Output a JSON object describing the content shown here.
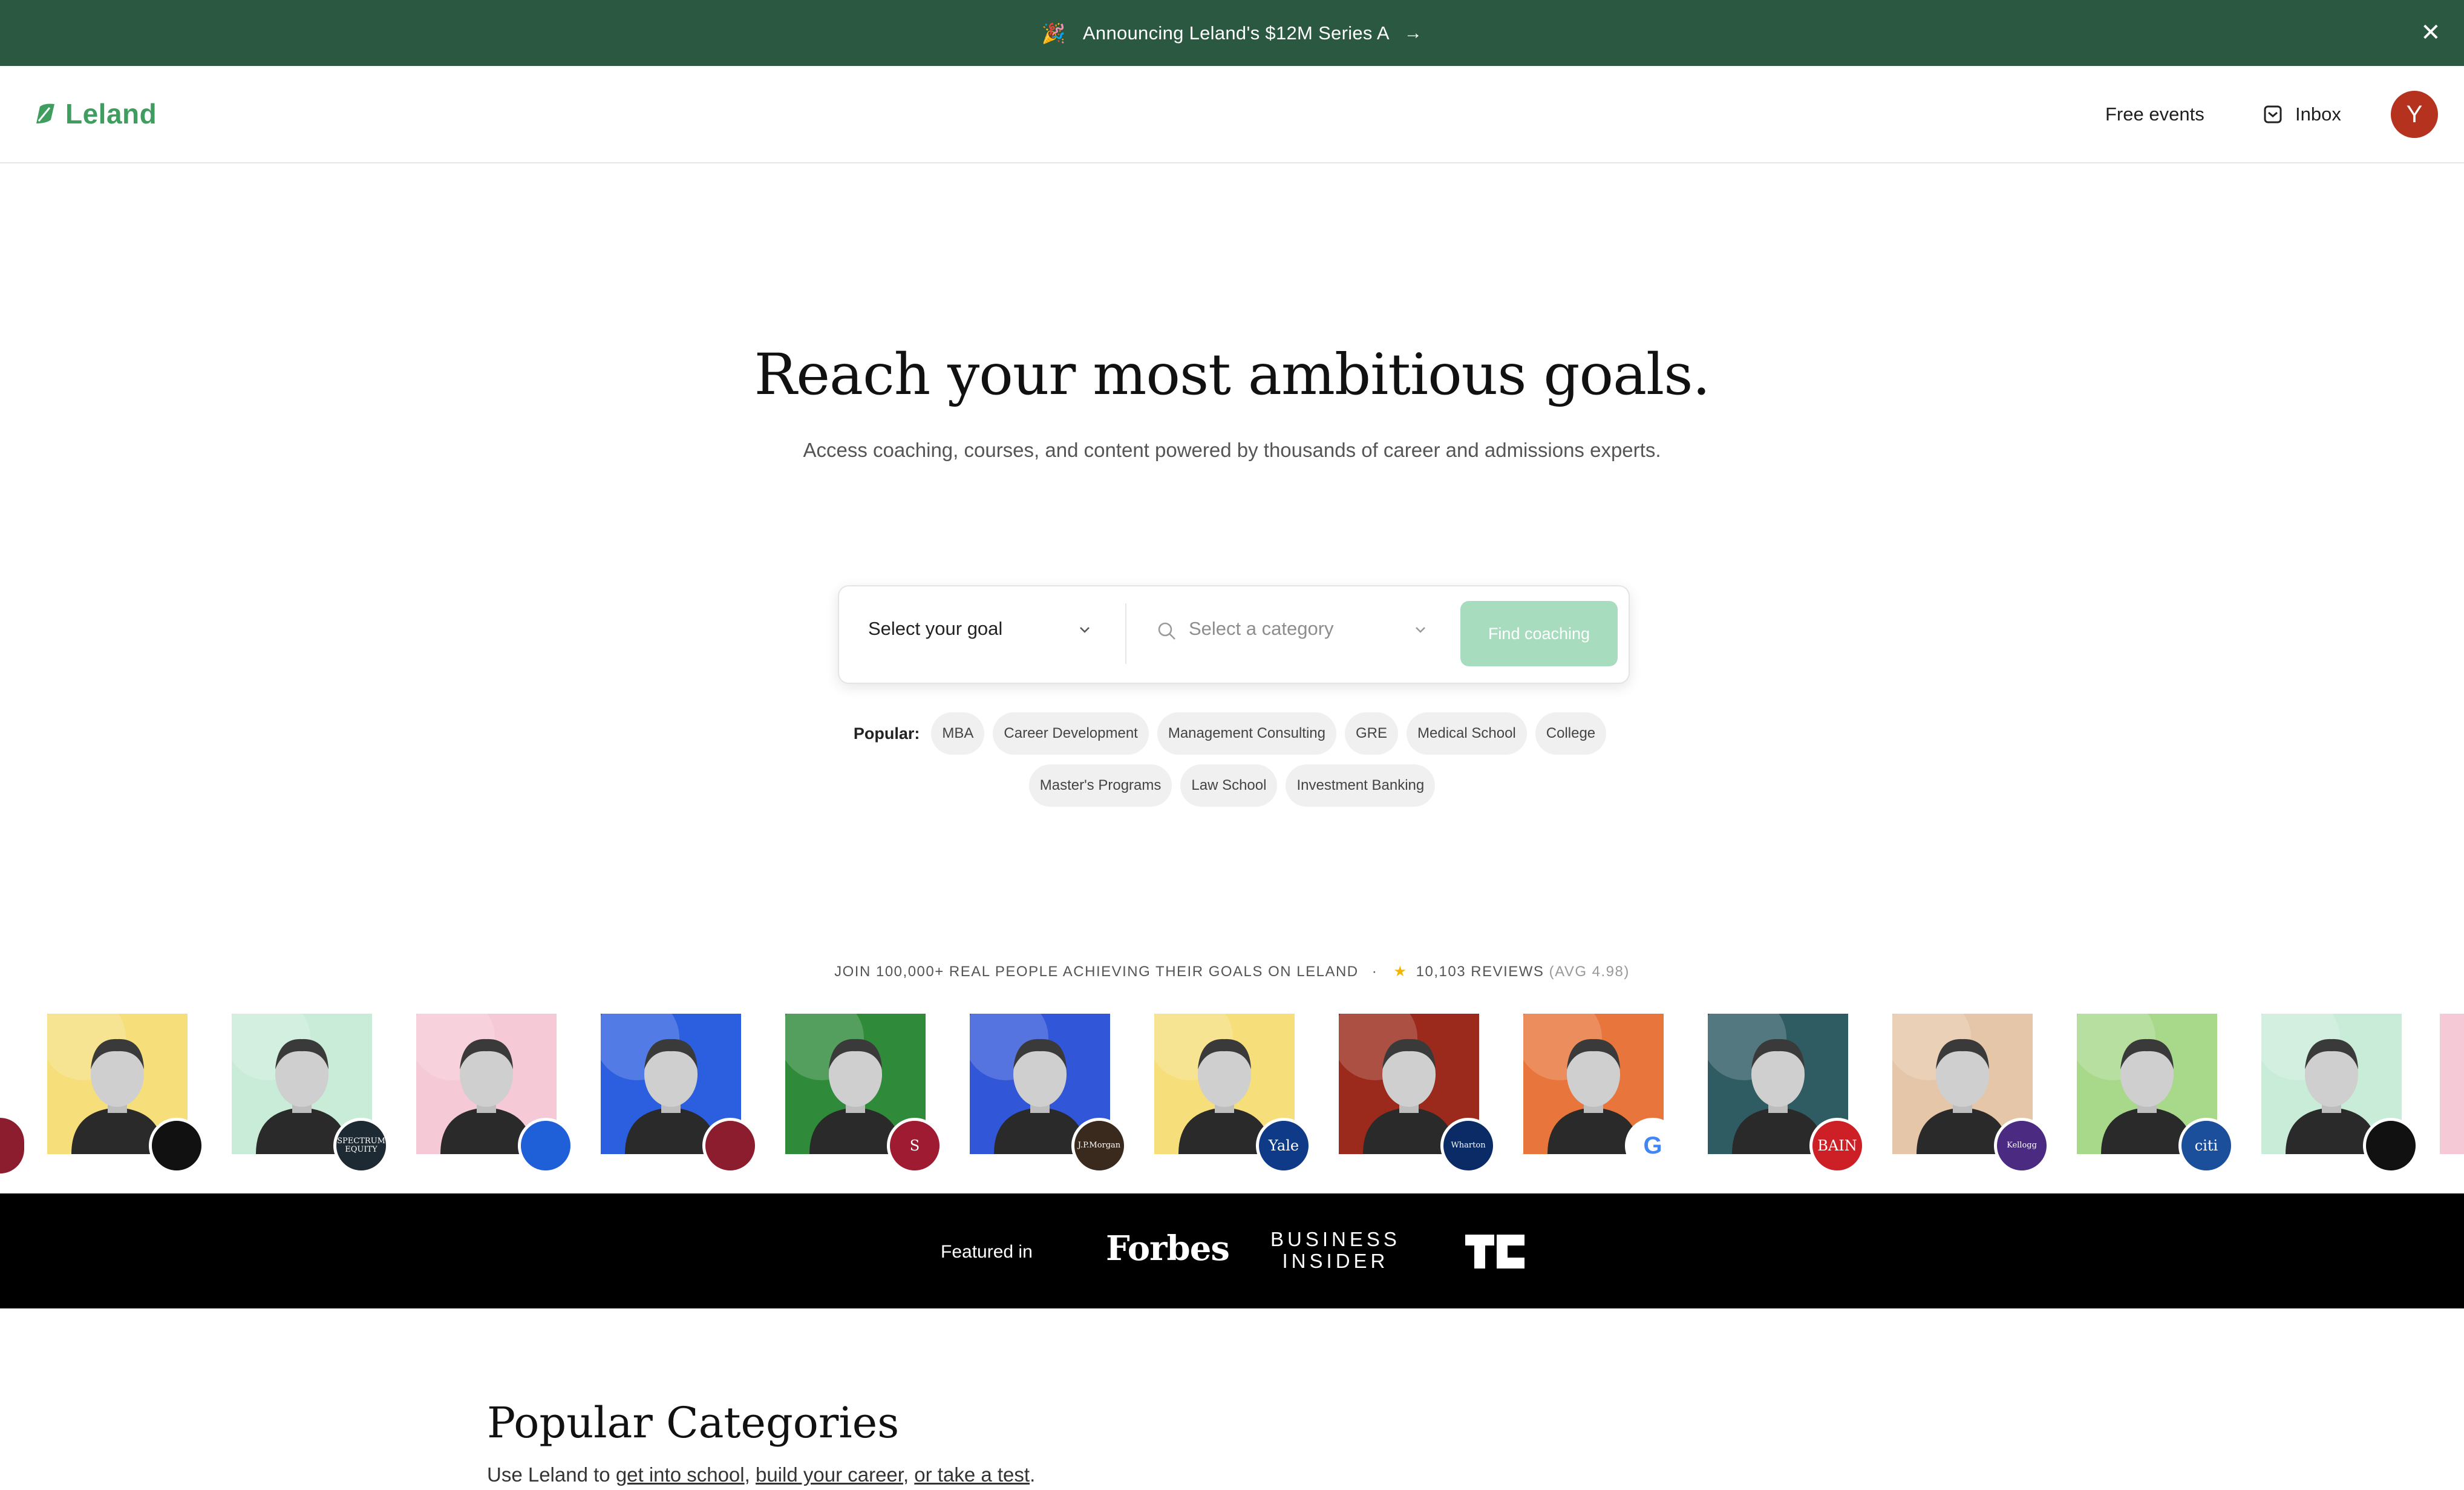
{
  "banner": {
    "text": "Announcing Leland's $12M Series A",
    "arrow": "→",
    "close": "✕",
    "confetti": "🎉"
  },
  "nav": {
    "logo": "Leland",
    "free_events": "Free events",
    "inbox": "Inbox",
    "avatar_initial": "Y"
  },
  "hero": {
    "title": "Reach your most ambitious goals.",
    "subtitle": "Access coaching, courses, and content powered by thousands of career and admissions experts."
  },
  "search": {
    "goal_label": "Select your goal",
    "category_placeholder": "Select a category",
    "button": "Find coaching"
  },
  "popular": {
    "label": "Popular:",
    "chips_row1": [
      "MBA",
      "Career Development",
      "Management Consulting",
      "GRE",
      "Medical School",
      "College"
    ],
    "chips_row2": [
      "Master's Programs",
      "Law School",
      "Investment Banking"
    ]
  },
  "social_proof": {
    "text": "JOIN 100,000+ REAL PEOPLE ACHIEVING THEIR GOALS ON LELAND",
    "sep": "·",
    "reviews": "10,103 REVIEWS",
    "avg": "(AVG 4.98)"
  },
  "people": [
    {
      "bg": "#f6df7a",
      "badge": "linktree",
      "badge_color": "#111111",
      "badge_text": ""
    },
    {
      "bg": "#c9ecd9",
      "badge": "spectrum-equity",
      "badge_color": "#1d2a33",
      "badge_text": "SPECTRUM EQUITY"
    },
    {
      "bg": "#f6c9d6",
      "badge": "atlassian",
      "badge_color": "#1f5fd8",
      "badge_text": ""
    },
    {
      "bg": "#2c5fe0",
      "badge": "harvard-business-school",
      "badge_color": "#8c1d2e",
      "badge_text": ""
    },
    {
      "bg": "#2f8a3a",
      "badge": "stanford-business",
      "badge_color": "#9e1b32",
      "badge_text": "S"
    },
    {
      "bg": "#3156d8",
      "badge": "jpmorgan",
      "badge_color": "#3a2a1e",
      "badge_text": "J.P.Morgan"
    },
    {
      "bg": "#f6df7a",
      "badge": "yale",
      "badge_color": "#0f3a87",
      "badge_text": "Yale"
    },
    {
      "bg": "#9c2a1c",
      "badge": "wharton",
      "badge_color": "#0b2b66",
      "badge_text": "Wharton"
    },
    {
      "bg": "#e8753b",
      "badge": "google",
      "badge_color": "#ffffff",
      "badge_text": "G"
    },
    {
      "bg": "#2f5b63",
      "badge": "bain",
      "badge_color": "#cc1f26",
      "badge_text": "BAIN"
    },
    {
      "bg": "#e6c6a8",
      "badge": "kellogg",
      "badge_color": "#4b2a82",
      "badge_text": "Kellogg"
    },
    {
      "bg": "#a8d88a",
      "badge": "citi",
      "badge_color": "#1b4f9b",
      "badge_text": "citi"
    },
    {
      "bg": "#c9ecd9",
      "badge": "peloton",
      "badge_color": "#111111",
      "badge_text": ""
    }
  ],
  "featured": {
    "label": "Featured in",
    "forbes": "Forbes",
    "bi_line1": "BUSINESS",
    "bi_line2": "INSIDER",
    "tc": "TC"
  },
  "popular_categories": {
    "title": "Popular Categories",
    "lead": "Use Leland to",
    "link1": "get into school",
    "comma": ",",
    "link2": "build your career",
    "link3": "or take a test",
    "end": "."
  }
}
